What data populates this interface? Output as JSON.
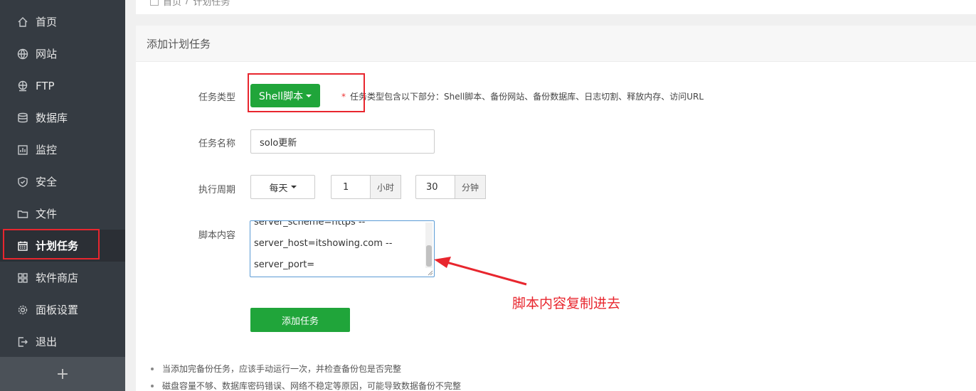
{
  "sidebar": {
    "items": [
      {
        "label": "首页",
        "icon": "home-icon"
      },
      {
        "label": "网站",
        "icon": "globe-icon"
      },
      {
        "label": "FTP",
        "icon": "ftp-icon"
      },
      {
        "label": "数据库",
        "icon": "database-icon"
      },
      {
        "label": "监控",
        "icon": "monitor-icon"
      },
      {
        "label": "安全",
        "icon": "shield-icon"
      },
      {
        "label": "文件",
        "icon": "folder-icon"
      },
      {
        "label": "计划任务",
        "icon": "calendar-icon",
        "active": true
      },
      {
        "label": "软件商店",
        "icon": "apps-icon"
      },
      {
        "label": "面板设置",
        "icon": "gear-icon"
      },
      {
        "label": "退出",
        "icon": "logout-icon"
      }
    ],
    "collapse_label": "+"
  },
  "breadcrumb": {
    "home": "首页",
    "separator": "/",
    "current": "计划任务"
  },
  "panel": {
    "title": "添加计划任务",
    "task_type": {
      "label": "任务类型",
      "value": "Shell脚本",
      "hint_star": "*",
      "hint": "任务类型包含以下部分：Shell脚本、备份网站、备份数据库、日志切割、释放内存、访问URL"
    },
    "task_name": {
      "label": "任务名称",
      "value": "solo更新"
    },
    "schedule": {
      "label": "执行周期",
      "period": "每天",
      "hour_value": "1",
      "hour_unit": "小时",
      "minute_value": "30",
      "minute_unit": "分钟"
    },
    "script": {
      "label": "脚本内容",
      "lines": [
        "server_scheme=https --",
        "server_host=itshowing.com --",
        "server_port="
      ]
    },
    "submit_label": "添加任务",
    "notes": [
      "当添加完备份任务，应该手动运行一次，并检查备份包是否完整",
      "磁盘容量不够、数据库密码错误、网络不稳定等原因，可能导致数据备份不完整"
    ]
  },
  "annotation": {
    "text": "脚本内容复制进去",
    "color": "#e8262e"
  },
  "colors": {
    "sidebar_bg": "#353b42",
    "primary_green": "#20a53a",
    "annotation_red": "#e8262e"
  }
}
